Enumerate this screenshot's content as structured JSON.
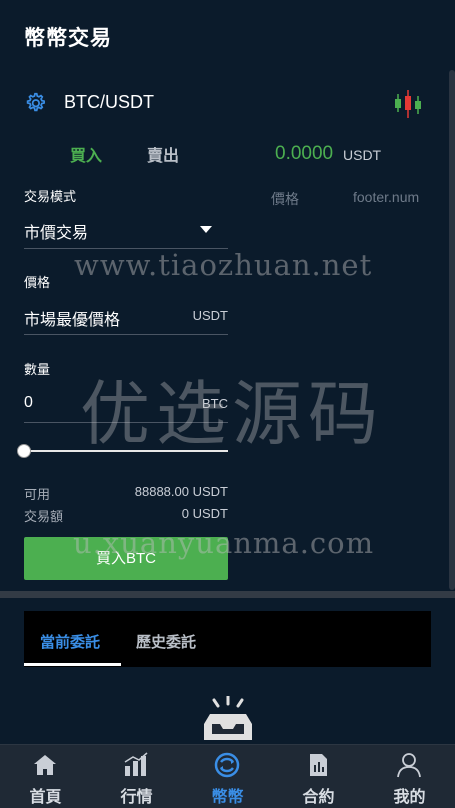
{
  "header": {
    "title": "幣幣交易"
  },
  "pair": {
    "symbol": "BTC/USDT",
    "settings_icon": "gear-icon",
    "chart_icon": "candlestick-icon"
  },
  "side_tabs": {
    "buy": "買入",
    "sell": "賣出"
  },
  "price": {
    "value": "0.0000",
    "unit": "USDT"
  },
  "order_book": {
    "price_header": "價格",
    "num_header": "footer.num"
  },
  "form": {
    "mode_label": "交易模式",
    "mode_value": "市價交易",
    "price_label": "價格",
    "price_value": "市場最優價格",
    "price_unit": "USDT",
    "amount_label": "數量",
    "amount_value": "0",
    "amount_unit": "BTC",
    "slider_percent": 0,
    "available_label": "可用",
    "available_value": "88888.00 USDT",
    "volume_label": "交易額",
    "volume_value": "0 USDT",
    "submit_label": "買入BTC"
  },
  "orders": {
    "current_tab": "當前委託",
    "history_tab": "歷史委託",
    "empty_icon": "empty-inbox-icon"
  },
  "tabbar": {
    "items": [
      {
        "label": "首頁",
        "icon": "home-icon"
      },
      {
        "label": "行情",
        "icon": "market-chart-icon"
      },
      {
        "label": "幣幣",
        "icon": "coin-exchange-icon",
        "active": true
      },
      {
        "label": "合約",
        "icon": "contract-document-icon"
      },
      {
        "label": "我的",
        "icon": "user-icon"
      }
    ]
  },
  "watermark": {
    "url1": "www.tiaozhuan.net",
    "brand": "优选源码",
    "url2": "u.xuanyuanma.com"
  },
  "colors": {
    "background": "#0b1b2b",
    "accent_green": "#4caf50",
    "accent_blue": "#3a8ee6"
  }
}
